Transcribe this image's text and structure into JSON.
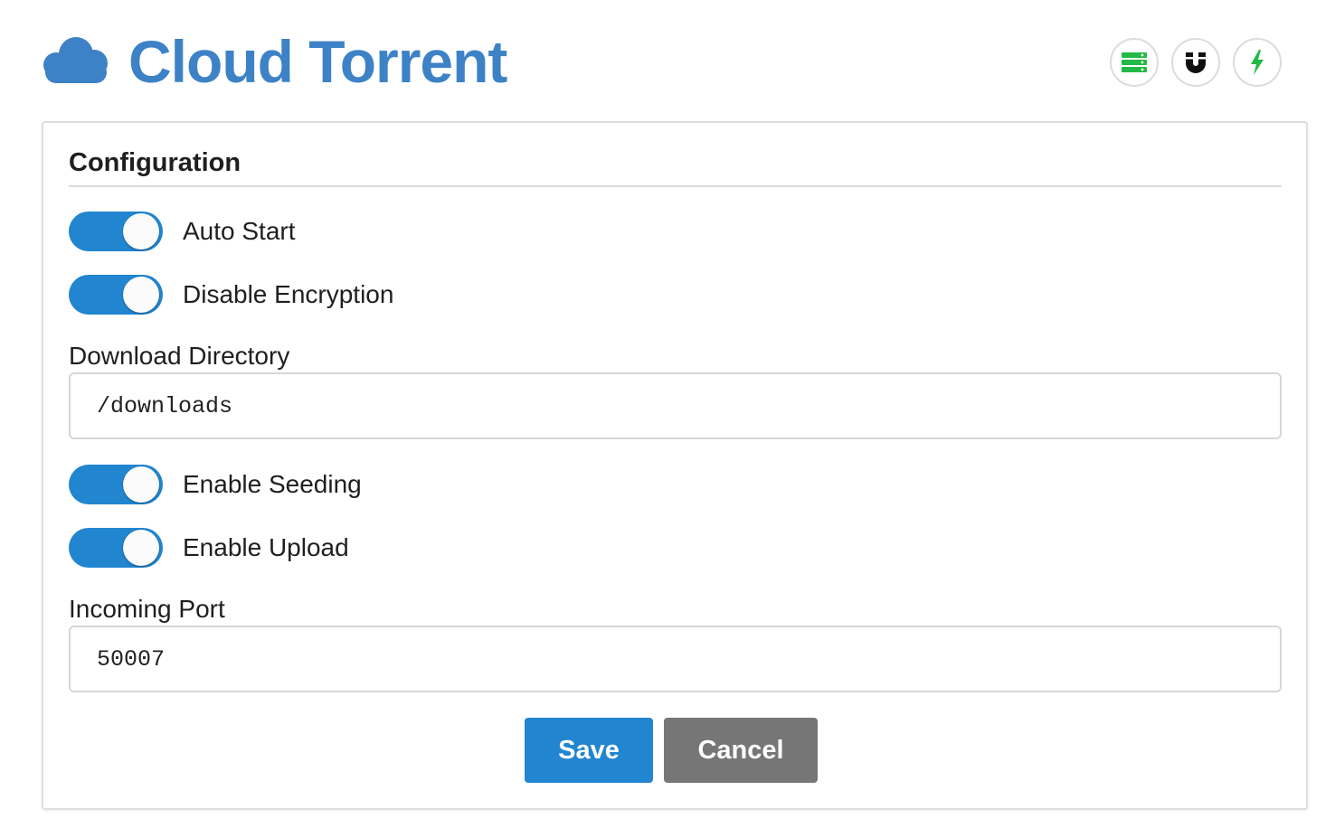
{
  "app": {
    "title": "Cloud Torrent",
    "accent_color": "#3d82c6"
  },
  "header_buttons": [
    {
      "icon": "server-icon",
      "color": "#21ba45"
    },
    {
      "icon": "magnet-icon",
      "color": "#111111"
    },
    {
      "icon": "lightning-icon",
      "color": "#21ba45"
    }
  ],
  "config": {
    "title": "Configuration",
    "toggles": [
      {
        "label": "Auto Start",
        "on": true
      },
      {
        "label": "Disable Encryption",
        "on": true
      },
      {
        "label": "Enable Seeding",
        "on": true
      },
      {
        "label": "Enable Upload",
        "on": true
      }
    ],
    "download_directory": {
      "label": "Download Directory",
      "value": "/downloads"
    },
    "incoming_port": {
      "label": "Incoming Port",
      "value": "50007"
    },
    "buttons": {
      "save": "Save",
      "cancel": "Cancel"
    },
    "toggle_on_color": "#2185d0",
    "save_color": "#2185d0",
    "cancel_color": "#767676"
  }
}
